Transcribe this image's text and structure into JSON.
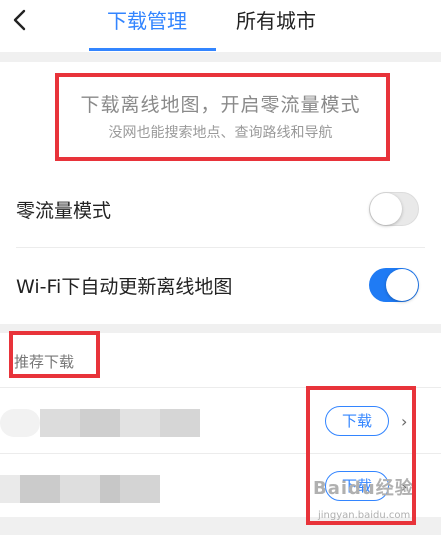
{
  "header": {
    "back_icon": "chevron-left-icon",
    "tabs": [
      {
        "label": "下载管理",
        "active": true
      },
      {
        "label": "所有城市",
        "active": false
      }
    ],
    "accent_color": "#3385ff"
  },
  "promo": {
    "title": "下载离线地图，开启零流量模式",
    "subtitle": "没网也能搜索地点、查询路线和导航"
  },
  "settings": [
    {
      "label": "零流量模式",
      "toggle_on": false
    },
    {
      "label": "Wi-Fi下自动更新离线地图",
      "toggle_on": true
    }
  ],
  "recommend": {
    "title": "推荐下载",
    "items": [
      {
        "download_label": "下载",
        "chevron_icon": "chevron-right-icon"
      },
      {
        "download_label": "下载",
        "chevron_icon": "chevron-right-icon"
      }
    ]
  },
  "watermark": {
    "logo_text": "Baidu经验",
    "url": "jingyan.baidu.com"
  },
  "annotation_color": "#e8333a",
  "toggle_on_color": "#1f7bf4"
}
